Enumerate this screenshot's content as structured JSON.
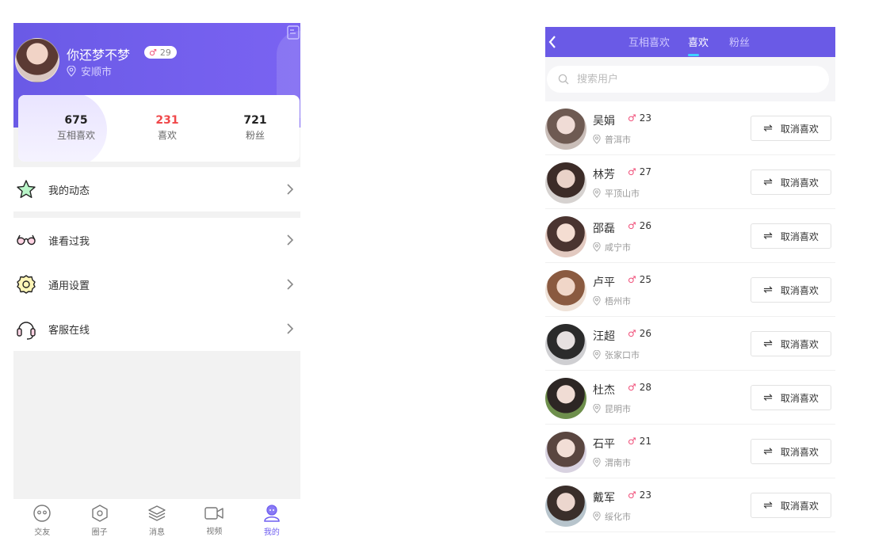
{
  "left": {
    "profile": {
      "name": "你还梦不梦",
      "age": "29",
      "location": "安顺市"
    },
    "stats": [
      {
        "value": "675",
        "label": "互相喜欢"
      },
      {
        "value": "231",
        "label": "喜欢"
      },
      {
        "value": "721",
        "label": "粉丝"
      }
    ],
    "menu": [
      {
        "label": "我的动态",
        "icon": "star-icon"
      },
      {
        "label": "谁看过我",
        "icon": "glasses-icon"
      },
      {
        "label": "通用设置",
        "icon": "gear-icon"
      },
      {
        "label": "客服在线",
        "icon": "headset-icon"
      }
    ],
    "tabbar": [
      {
        "label": "交友",
        "icon": "face-icon"
      },
      {
        "label": "圈子",
        "icon": "hexagon-icon"
      },
      {
        "label": "消息",
        "icon": "layers-icon"
      },
      {
        "label": "视频",
        "icon": "video-camera-icon"
      },
      {
        "label": "我的",
        "icon": "profile-icon"
      }
    ],
    "active_tab": "我的"
  },
  "right": {
    "tabs": [
      {
        "label": "互相喜欢"
      },
      {
        "label": "喜欢"
      },
      {
        "label": "粉丝"
      }
    ],
    "active_tab": "喜欢",
    "search": {
      "placeholder": "搜索用户"
    },
    "unlike_label": "取消喜欢",
    "users": [
      {
        "name": "吴娟",
        "age": "23",
        "city": "普洱市"
      },
      {
        "name": "林芳",
        "age": "27",
        "city": "平顶山市"
      },
      {
        "name": "邵磊",
        "age": "26",
        "city": "咸宁市"
      },
      {
        "name": "卢平",
        "age": "25",
        "city": "梧州市"
      },
      {
        "name": "汪超",
        "age": "26",
        "city": "张家口市"
      },
      {
        "name": "杜杰",
        "age": "28",
        "city": "昆明市"
      },
      {
        "name": "石平",
        "age": "21",
        "city": "渭南市"
      },
      {
        "name": "戴军",
        "age": "23",
        "city": "绥化市"
      }
    ]
  },
  "colors": {
    "primary": "#6a5ae6",
    "liked_count": "#f0484a",
    "gender_icon": "#f0507a",
    "active_tab_indicator": "#3fd1ff"
  }
}
